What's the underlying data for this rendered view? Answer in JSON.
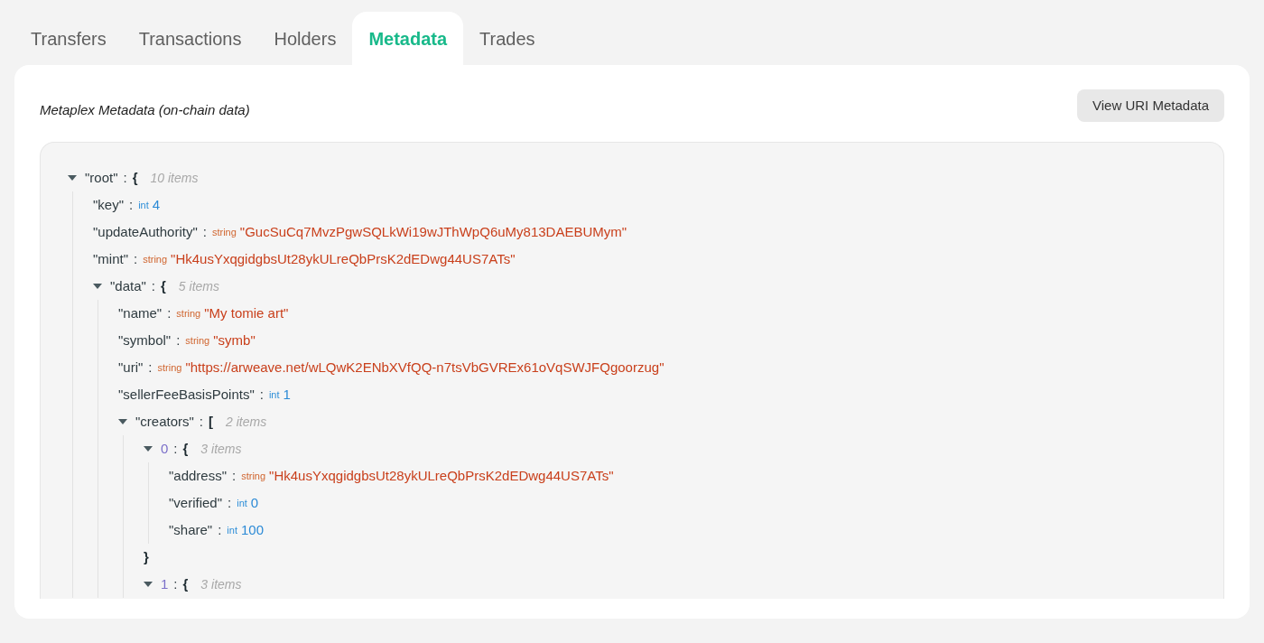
{
  "tabs": [
    {
      "label": "Transfers",
      "selected": false
    },
    {
      "label": "Transactions",
      "selected": false
    },
    {
      "label": "Holders",
      "selected": false
    },
    {
      "label": "Metadata",
      "selected": true
    },
    {
      "label": "Trades",
      "selected": false
    }
  ],
  "section_title": "Metaplex Metadata (on-chain data)",
  "view_button": "View URI Metadata",
  "tree": {
    "kind": "container",
    "key": "\"root\"",
    "is_index": false,
    "sep": ":",
    "open": "{",
    "count": "10 items",
    "expanded": true,
    "children": [
      {
        "kind": "value",
        "key": "\"key\"",
        "is_index": false,
        "sep": ":",
        "type": "int",
        "value": "4"
      },
      {
        "kind": "value",
        "key": "\"updateAuthority\"",
        "is_index": false,
        "sep": ":",
        "type": "string",
        "value": "\"GucSuCq7MvzPgwSQLkWi19wJThWpQ6uMy813DAEBUMym\""
      },
      {
        "kind": "value",
        "key": "\"mint\"",
        "is_index": false,
        "sep": ":",
        "type": "string",
        "value": "\"Hk4usYxqgidgbsUt28ykULreQbPrsK2dEDwg44US7ATs\""
      },
      {
        "kind": "container",
        "key": "\"data\"",
        "is_index": false,
        "sep": ":",
        "open": "{",
        "count": "5 items",
        "expanded": true,
        "children": [
          {
            "kind": "value",
            "key": "\"name\"",
            "is_index": false,
            "sep": ":",
            "type": "string",
            "value": "\"My tomie art\""
          },
          {
            "kind": "value",
            "key": "\"symbol\"",
            "is_index": false,
            "sep": ":",
            "type": "string",
            "value": "\"symb\""
          },
          {
            "kind": "value",
            "key": "\"uri\"",
            "is_index": false,
            "sep": ":",
            "type": "string",
            "value": "\"https://arweave.net/wLQwK2ENbXVfQQ-n7tsVbGVREx61oVqSWJFQgoorzug\""
          },
          {
            "kind": "value",
            "key": "\"sellerFeeBasisPoints\"",
            "is_index": false,
            "sep": ":",
            "type": "int",
            "value": "1"
          },
          {
            "kind": "container",
            "key": "\"creators\"",
            "is_index": false,
            "sep": ":",
            "open": "[",
            "count": "2 items",
            "expanded": true,
            "children": [
              {
                "kind": "container",
                "key": "0",
                "is_index": true,
                "sep": ":",
                "open": "{",
                "count": "3 items",
                "expanded": true,
                "close": "}",
                "children": [
                  {
                    "kind": "value",
                    "key": "\"address\"",
                    "is_index": false,
                    "sep": ":",
                    "type": "string",
                    "value": "\"Hk4usYxqgidgbsUt28ykULreQbPrsK2dEDwg44US7ATs\""
                  },
                  {
                    "kind": "value",
                    "key": "\"verified\"",
                    "is_index": false,
                    "sep": ":",
                    "type": "int",
                    "value": "0"
                  },
                  {
                    "kind": "value",
                    "key": "\"share\"",
                    "is_index": false,
                    "sep": ":",
                    "type": "int",
                    "value": "100"
                  }
                ]
              },
              {
                "kind": "container",
                "key": "1",
                "is_index": true,
                "sep": ":",
                "open": "{",
                "count": "3 items",
                "expanded": true
              }
            ]
          }
        ]
      }
    ]
  }
}
